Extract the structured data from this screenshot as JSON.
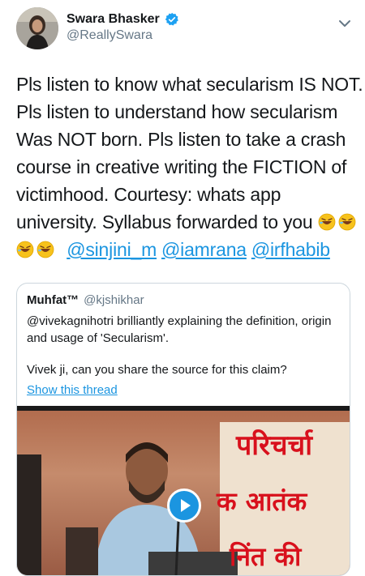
{
  "tweet": {
    "author_name": "Swara Bhasker",
    "author_handle": "@ReallySwara",
    "text_lines": [
      "Pls listen to know what secularism IS NOT.",
      "Pls listen to understand how secularism",
      "Was NOT born. Pls listen to take a crash",
      "course in creative writing the FICTION of",
      "victimhood. Courtesy: whats app",
      "university. Syllabus forwarded to you"
    ],
    "mentions": [
      "@sinjini_m",
      "@iamrana",
      "@irfhabib"
    ],
    "icons": [
      "verified-badge-icon",
      "chevron-down-icon",
      "rofl-emoji-icon"
    ]
  },
  "quoted": {
    "name": "Muhfat™",
    "handle": "@kjshikhar",
    "text": "@vivekagnihotri brilliantly explaining the definition, origin and usage of 'Secularism'.",
    "question": "Vivek ji, can you share the source for this claim?",
    "show_thread": "Show this thread",
    "video_banner_line1": "परिचर्चा",
    "video_banner_line2": "क आतंक",
    "video_banner_line3": "निंत की"
  },
  "colors": {
    "link": "#1b95e0",
    "secondary": "#657786",
    "text": "#14171a"
  }
}
